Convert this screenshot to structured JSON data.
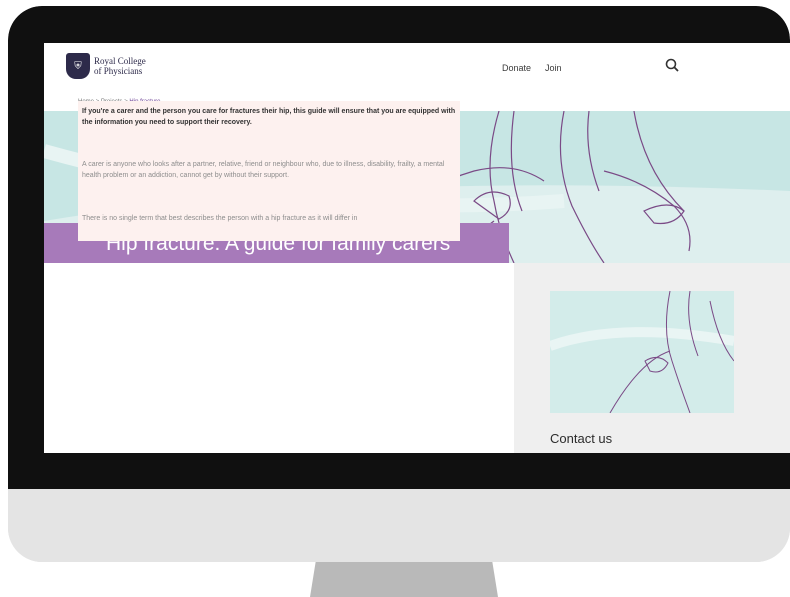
{
  "header": {
    "logo_line1": "Royal College",
    "logo_line2": "of Physicians",
    "nav": [
      "Donate",
      "Join"
    ]
  },
  "breadcrumb": {
    "items": [
      "Home",
      "Projects"
    ],
    "separator": ">",
    "current": "Hip fracture"
  },
  "hero": {
    "title": "Hip fracture: A guide for family carers"
  },
  "content": {
    "lead": "If you're a carer and the person you care for fractures their hip, this guide will ensure that you are equipped with the information you need to support their recovery.",
    "paragraph1": "A carer is anyone who looks after a partner, relative, friend or neighbour who, due to illness, disability, frailty, a mental health problem or an addiction, cannot get by without their support.",
    "paragraph2": "There is no single term that best describes the person with a hip fracture as it will differ in"
  },
  "sidebar": {
    "heading": "Contact us"
  },
  "colors": {
    "accent_purple": "#a77aba",
    "hero_teal": "#c7e6e4",
    "logo_navy": "#2d2a4a"
  }
}
